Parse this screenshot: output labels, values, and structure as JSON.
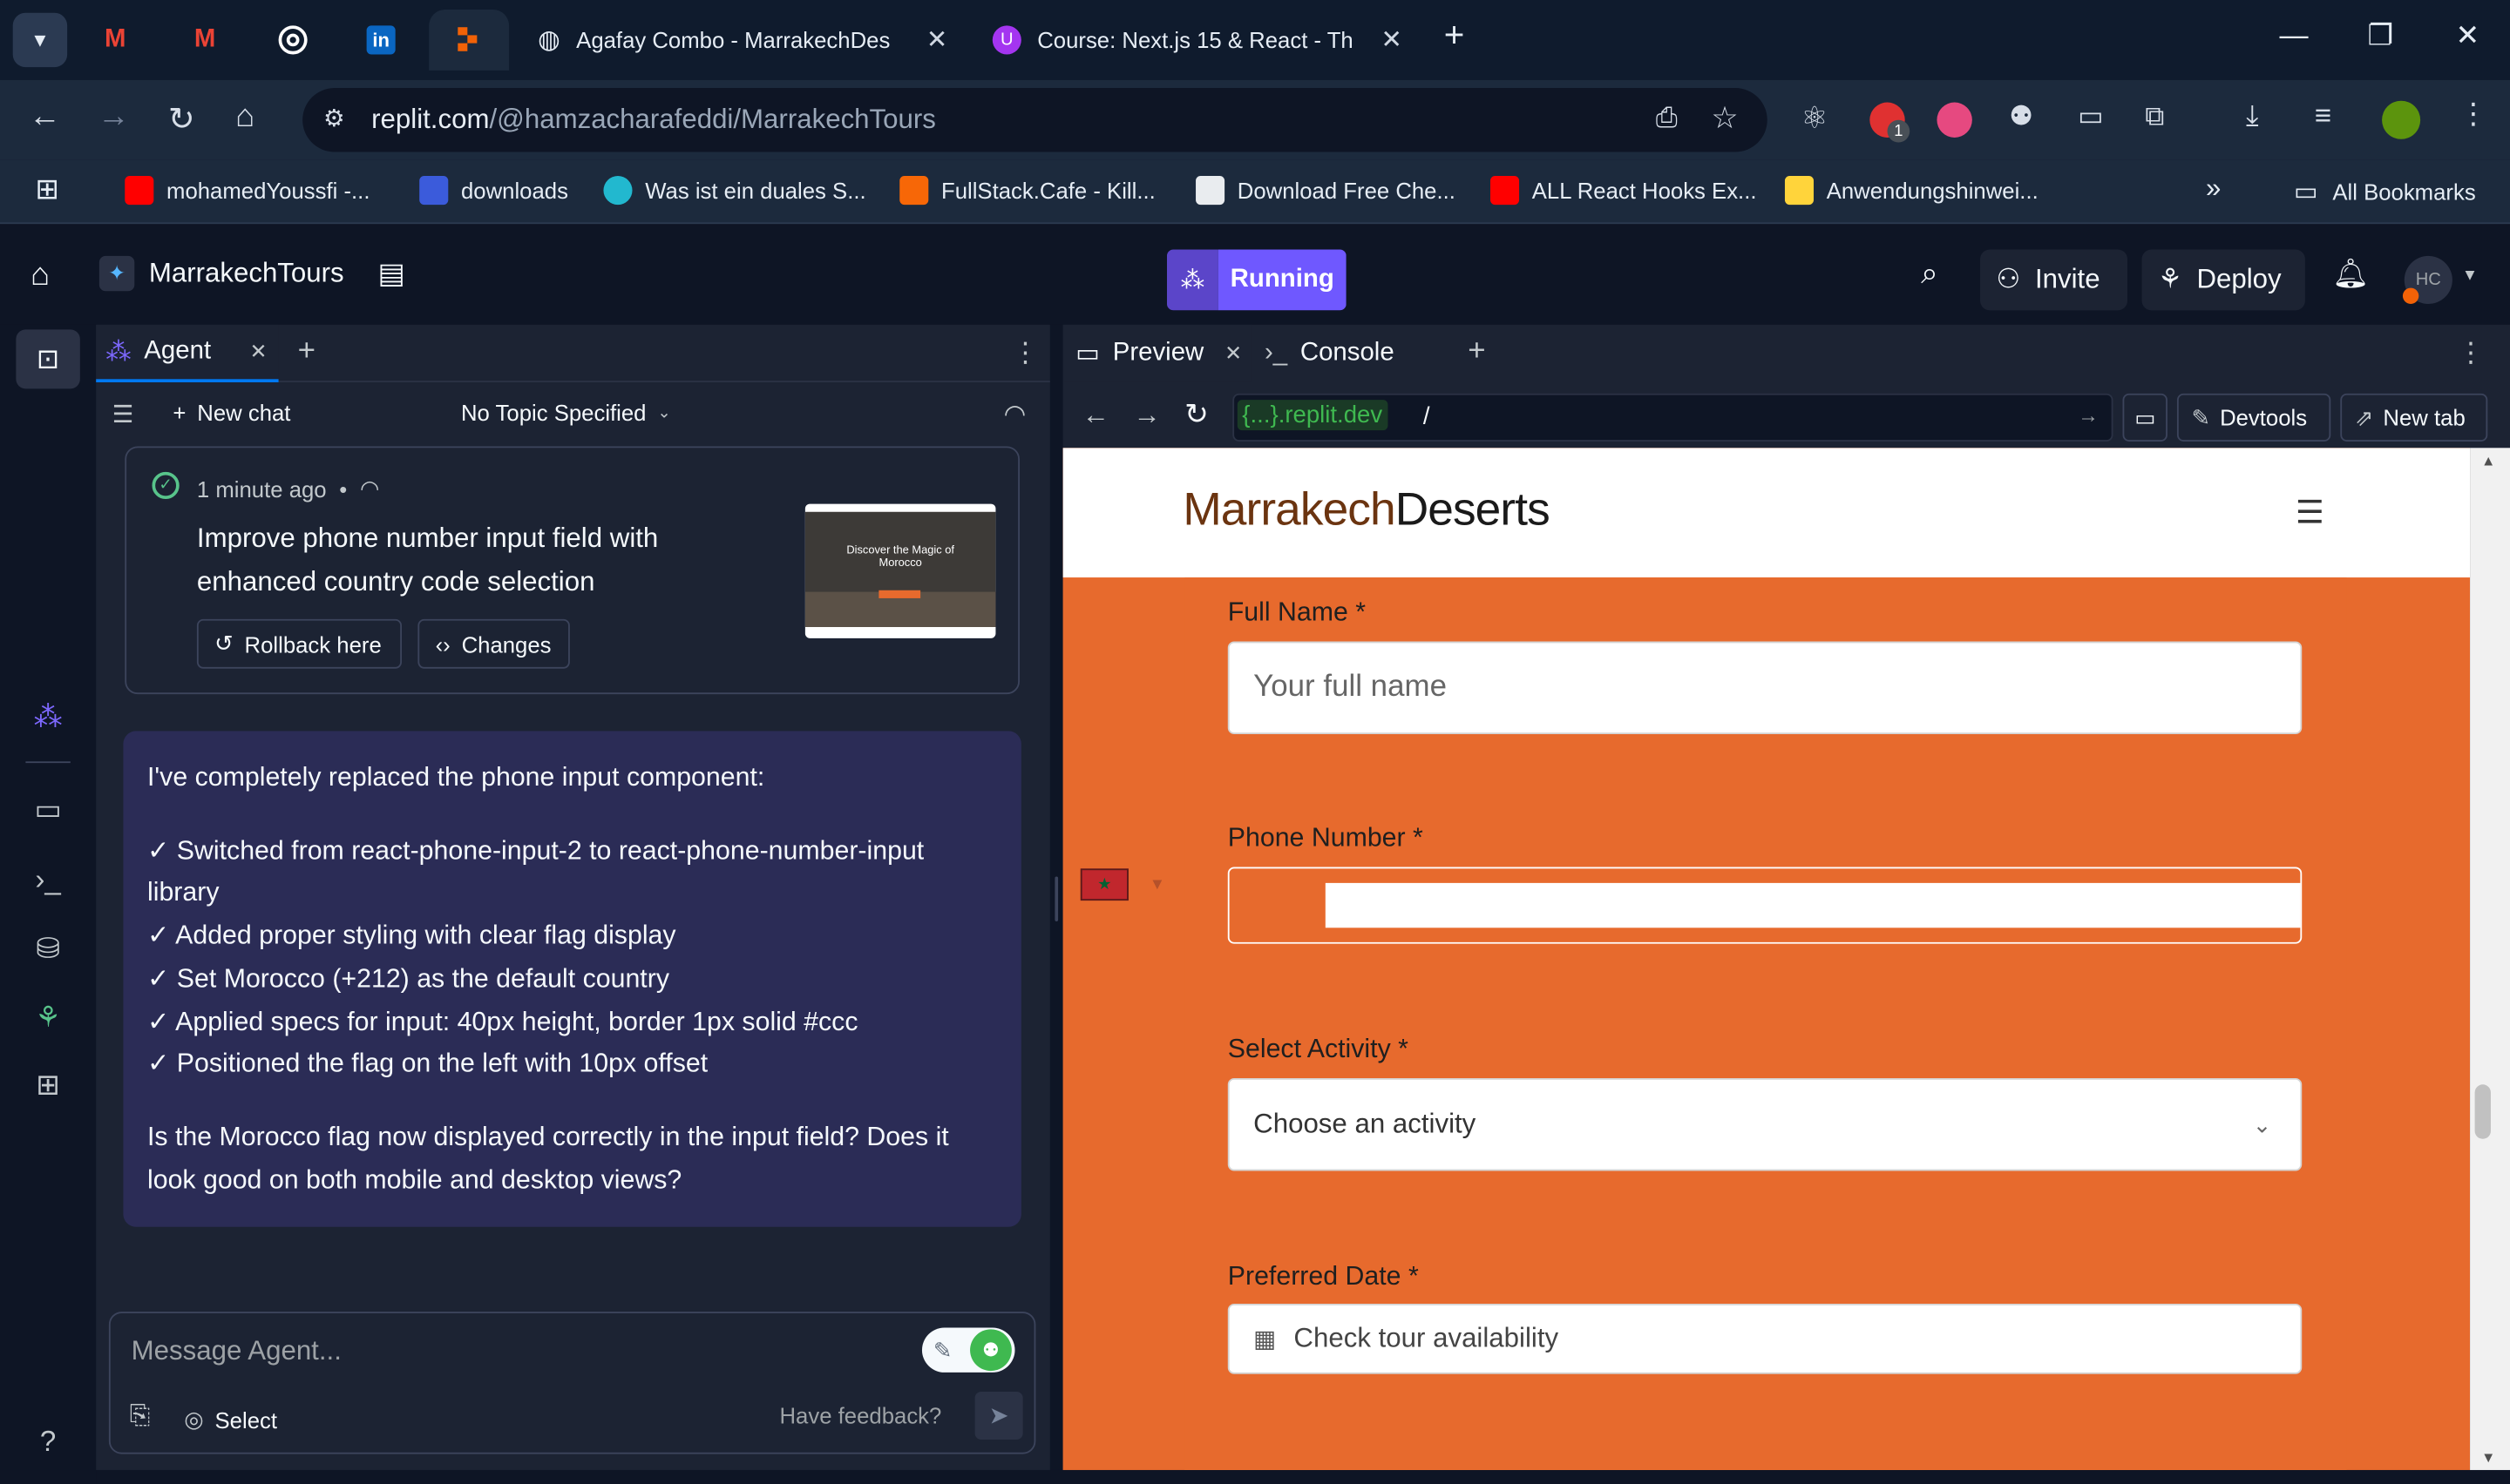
{
  "browser": {
    "tabs": [
      {
        "title": "Agafay Combo - MarrakechDes",
        "active": true
      },
      {
        "title": "Course: Next.js 15 & React - Th",
        "active": false
      }
    ],
    "pinned_tabs": [
      "gmail-icon",
      "gmail-icon",
      "openai-icon",
      "linkedin-icon",
      "replit-icon"
    ],
    "url_host": "replit.com",
    "url_path": "/@hamzacharafeddi/MarrakechTours",
    "extension_badges": {
      "ext1_count": "1"
    },
    "bookmarks": [
      {
        "label": "mohamedYoussfi -...",
        "color": "#ff0000"
      },
      {
        "label": "downloads",
        "color": "#3b5bdb"
      },
      {
        "label": "Was ist ein duales S...",
        "color": "#22b8cf"
      },
      {
        "label": "FullStack.Cafe - Kill...",
        "color": "#f76707"
      },
      {
        "label": "Download Free Che...",
        "color": "#e9ecef"
      },
      {
        "label": "ALL React Hooks Ex...",
        "color": "#ff0000"
      },
      {
        "label": "Anwendungshinwei...",
        "color": "#ffd43b"
      }
    ],
    "all_bookmarks": "All Bookmarks",
    "overflow": "»"
  },
  "replit": {
    "project_name": "MarrakechTours",
    "run_status": "Running",
    "invite_label": "Invite",
    "deploy_label": "Deploy",
    "avatar_initials": "HC"
  },
  "agent": {
    "tab_label": "Agent",
    "new_chat": "New chat",
    "topic": "No Topic Specified",
    "checkpoint": {
      "time": "1 minute ago",
      "title_line1": "Improve phone number input field with",
      "title_line2": "enhanced country code selection",
      "rollback_label": "Rollback here",
      "changes_label": "Changes",
      "thumb_heading": "Discover the Magic of",
      "thumb_heading2": "Morocco"
    },
    "message": {
      "intro": "I've completely replaced the phone input component:",
      "bullets": [
        "✓ Switched from react-phone-input-2 to react-phone-number-input library",
        "✓ Added proper styling with clear flag display",
        "✓ Set Morocco (+212) as the default country",
        "✓ Applied specs for input: 40px height, border 1px solid #ccc",
        "✓ Positioned the flag on the left with 10px offset"
      ],
      "question": "Is the Morocco flag now displayed correctly in the input field? Does it look good on both mobile and desktop views?"
    },
    "composer": {
      "placeholder": "Message Agent...",
      "select_label": "Select",
      "feedback_label": "Have feedback?"
    }
  },
  "preview": {
    "preview_tab": "Preview",
    "console_tab": "Console",
    "address_prefix": "{...}",
    "address_domain": ".replit.dev",
    "address_path": "/",
    "devtools_label": "Devtools",
    "newtab_label": "New tab",
    "site": {
      "logo_part1": "Marrakech",
      "logo_part2": "Deserts",
      "fields": {
        "full_name_label": "Full Name *",
        "full_name_placeholder": "Your full name",
        "phone_label": "Phone Number *",
        "activity_label": "Select Activity *",
        "activity_value": "Choose an activity",
        "date_label": "Preferred Date *",
        "date_placeholder": "Check tour availability"
      }
    }
  },
  "colors": {
    "replit_bg": "#0e1525",
    "panel_bg": "#1c2333",
    "accent_purple": "#6f58ff",
    "site_orange": "#e76a2d",
    "message_bubble": "#2b2c56"
  }
}
